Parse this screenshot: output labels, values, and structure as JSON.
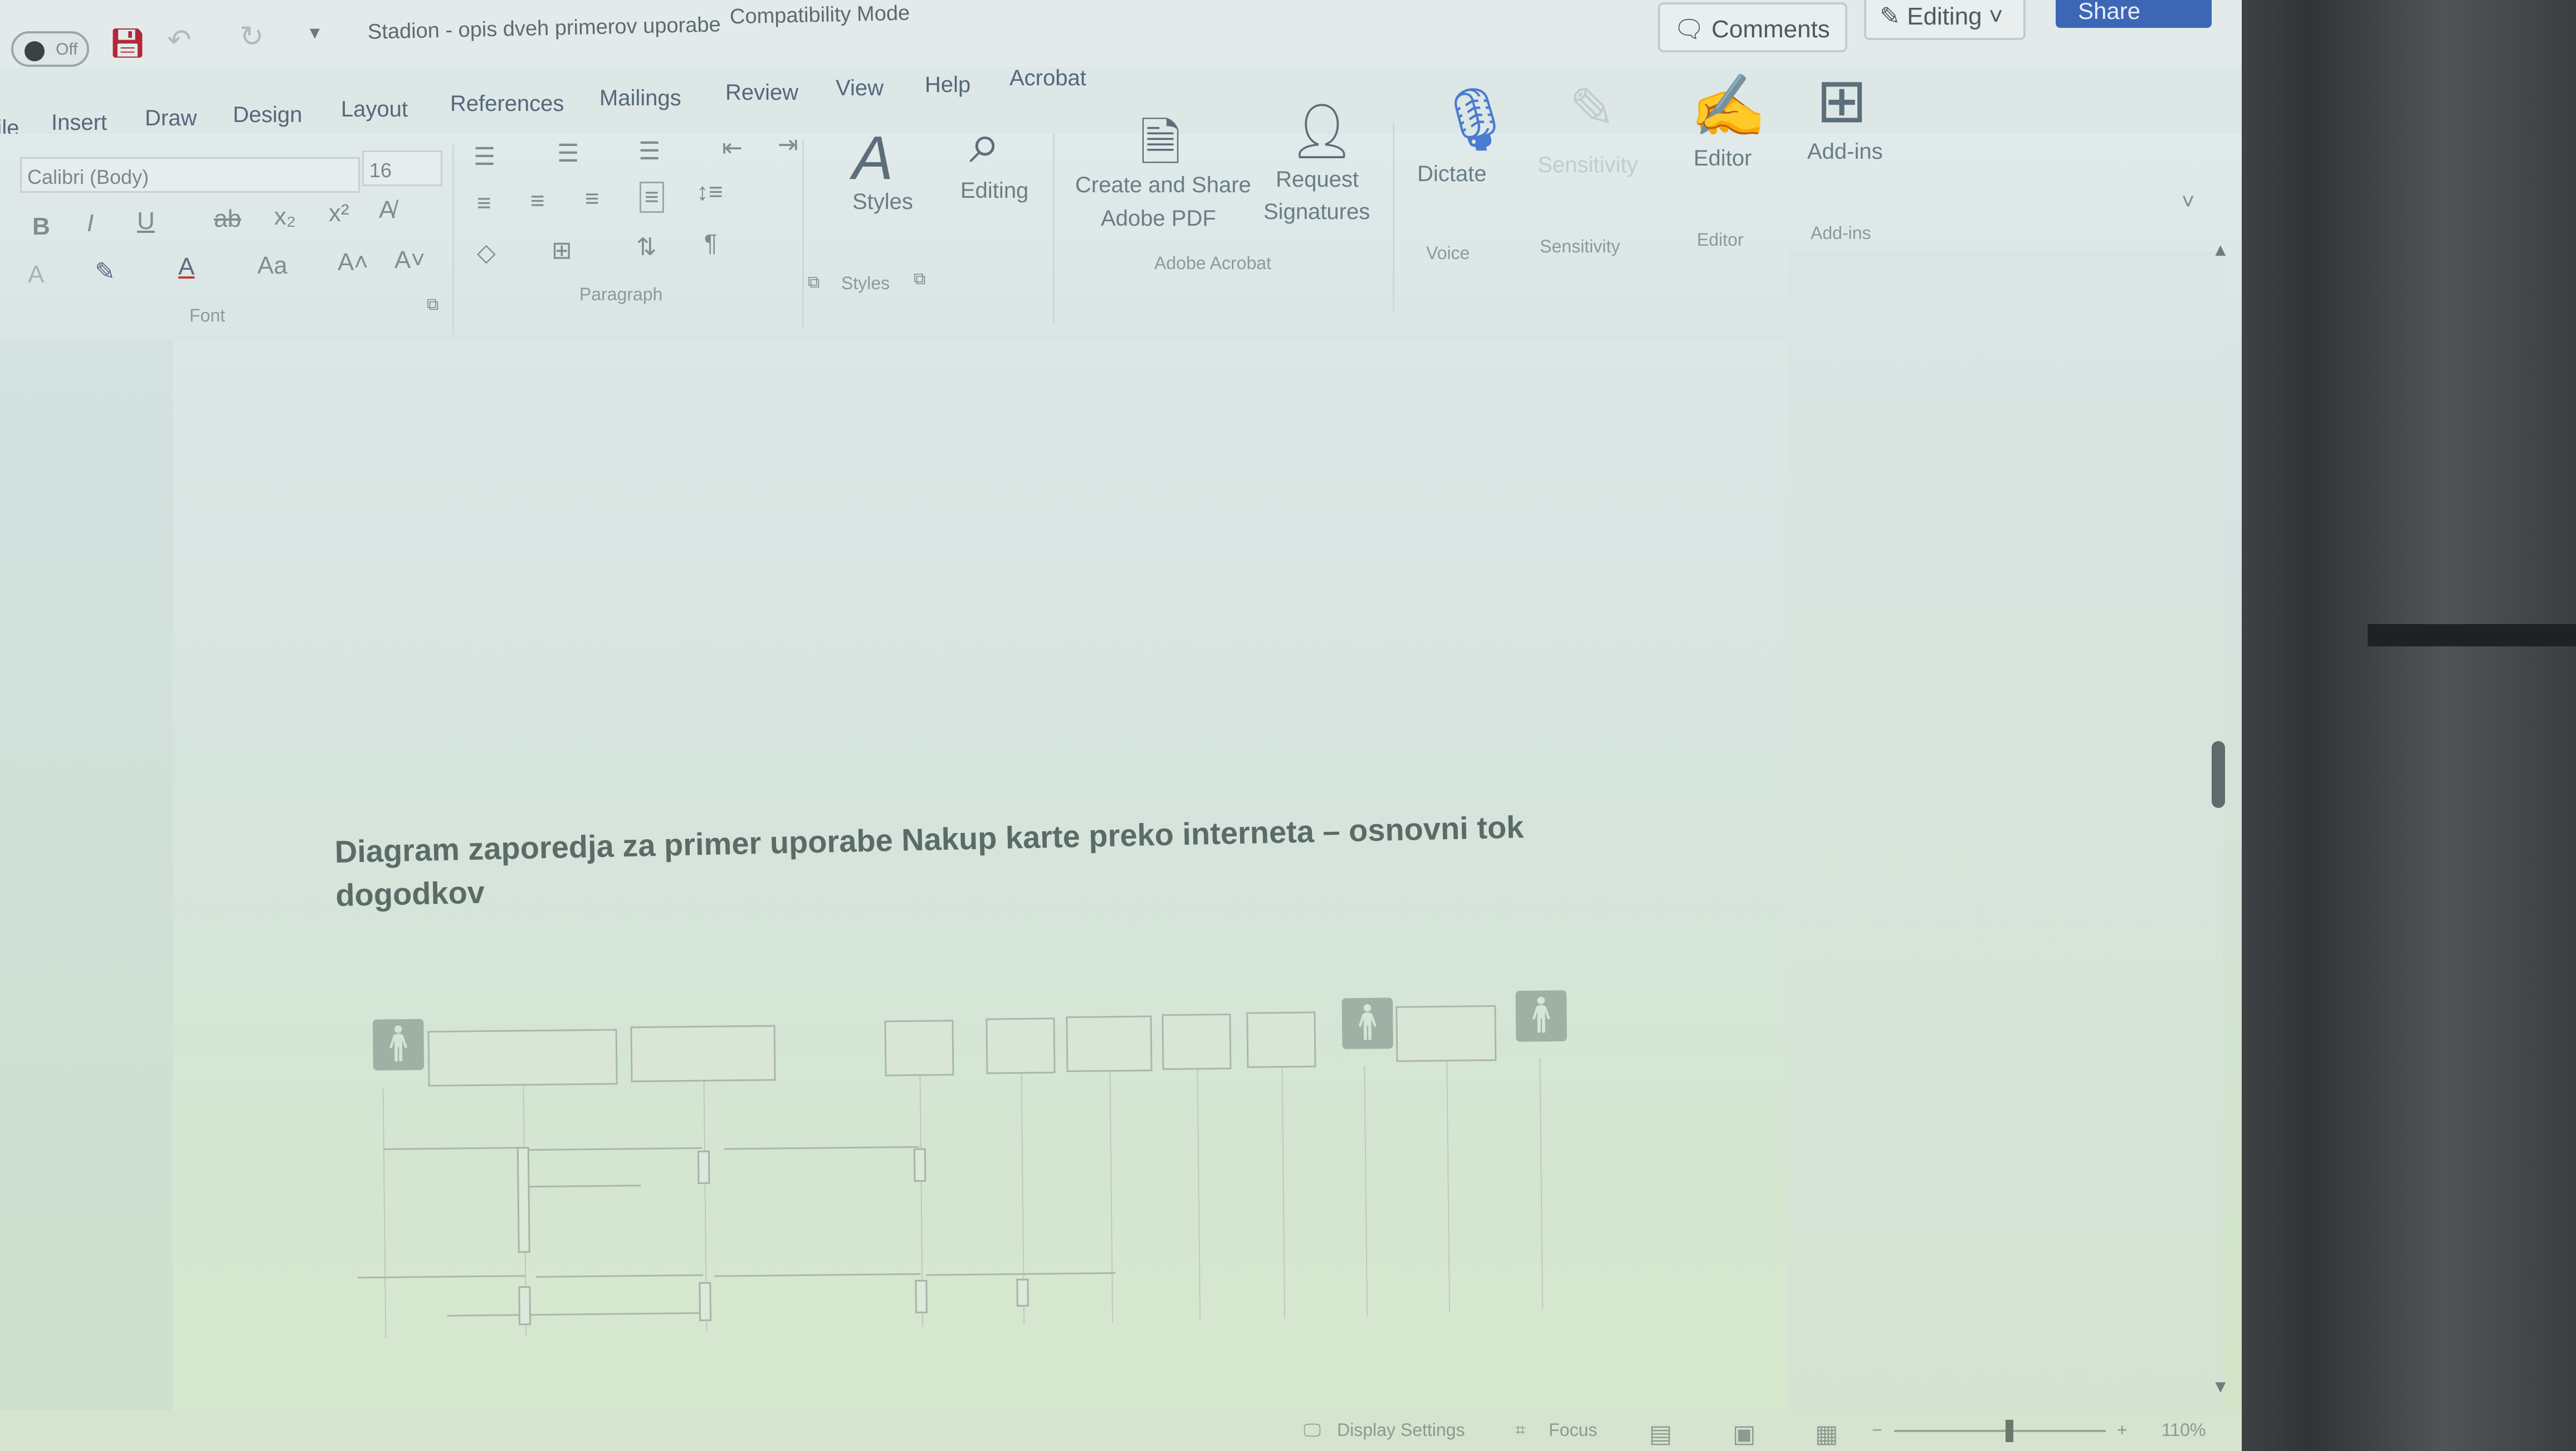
{
  "titlebar": {
    "autosave_state": "Off",
    "document_title": "Stadion - opis dveh primerov uporabe",
    "mode": "Compatibility Mode",
    "comments_label": "Comments",
    "editing_label": "Editing",
    "share_label": "Share"
  },
  "tabs": [
    "File",
    "Insert",
    "Draw",
    "Design",
    "Layout",
    "References",
    "Mailings",
    "Review",
    "View",
    "Help",
    "Acrobat"
  ],
  "ribbon": {
    "font_name": "Calibri (Body)",
    "font_size": "16",
    "groups": {
      "font": "Font",
      "paragraph": "Paragraph",
      "styles": "Styles",
      "adobe_acrobat": "Adobe Acrobat",
      "voice": "Voice",
      "sensitivity": "Sensitivity",
      "editor": "Editor",
      "addins": "Add-ins"
    },
    "buttons": {
      "styles": "Styles",
      "editing": "Editing",
      "create_share_line1": "Create and Share",
      "create_share_line2": "Adobe PDF",
      "request_line1": "Request",
      "request_line2": "Signatures",
      "dictate": "Dictate",
      "sensitivity": "Sensitivity",
      "editor": "Editor",
      "addins": "Add-ins"
    }
  },
  "document": {
    "heading": "Diagram zaporedja za primer uporabe Nakup karte preko interneta – osnovni tok dogodkov"
  },
  "statusbar": {
    "display_settings": "Display Settings",
    "focus": "Focus",
    "zoom": "110%"
  },
  "colors": {
    "share_button": "#3d67b5",
    "scroll_thumb": "#5f6a6b"
  }
}
